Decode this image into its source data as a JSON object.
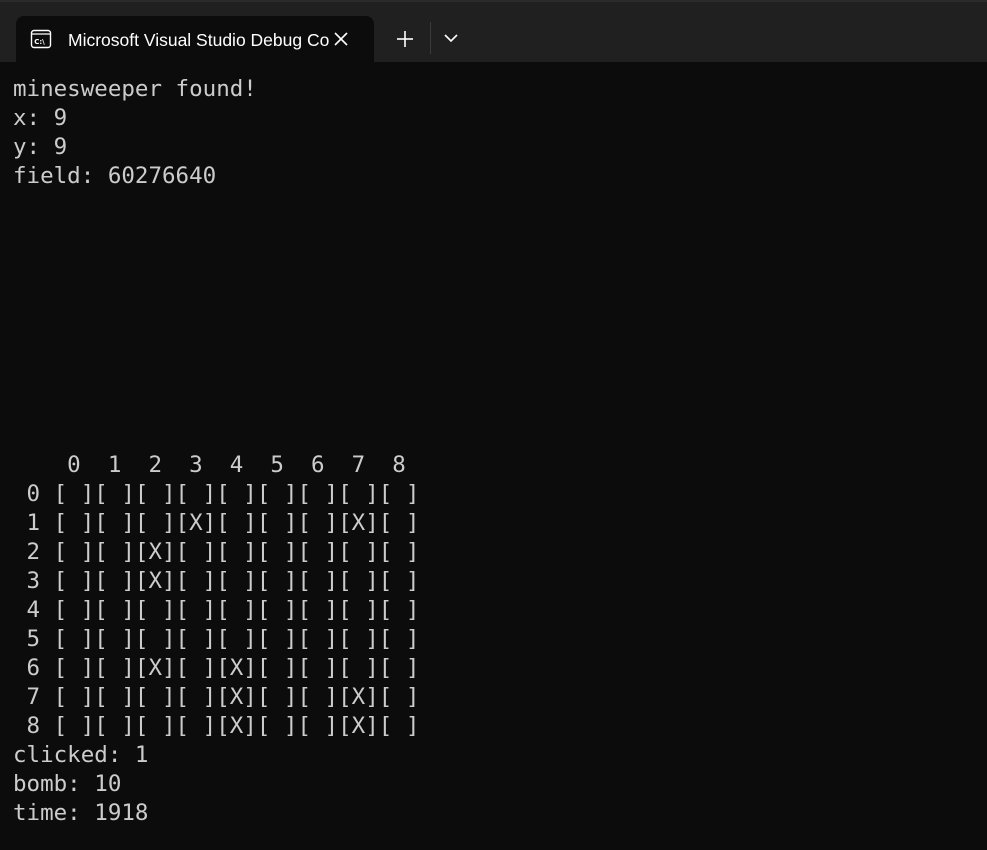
{
  "tab": {
    "title": "Microsoft Visual Studio Debug Console",
    "icon": "console-icon"
  },
  "console": {
    "header": [
      "minesweeper found!",
      "x: 9",
      "y: 9",
      "field: 60276640"
    ],
    "grid_header": "    0  1  2  3  4  5  6  7  8",
    "grid_rows": [
      " 0 [ ][ ][ ][ ][ ][ ][ ][ ][ ]",
      " 1 [ ][ ][ ][X][ ][ ][ ][X][ ]",
      " 2 [ ][ ][X][ ][ ][ ][ ][ ][ ]",
      " 3 [ ][ ][X][ ][ ][ ][ ][ ][ ]",
      " 4 [ ][ ][ ][ ][ ][ ][ ][ ][ ]",
      " 5 [ ][ ][ ][ ][ ][ ][ ][ ][ ]",
      " 6 [ ][ ][X][ ][X][ ][ ][ ][ ]",
      " 7 [ ][ ][ ][ ][X][ ][ ][X][ ]",
      " 8 [ ][ ][ ][ ][X][ ][ ][X][ ]"
    ],
    "footer": [
      "clicked: 1",
      "bomb: 10",
      "time: 1918"
    ]
  },
  "colors": {
    "background": "#0c0c0c",
    "text": "#cccccc",
    "tabbar": "#202020"
  }
}
